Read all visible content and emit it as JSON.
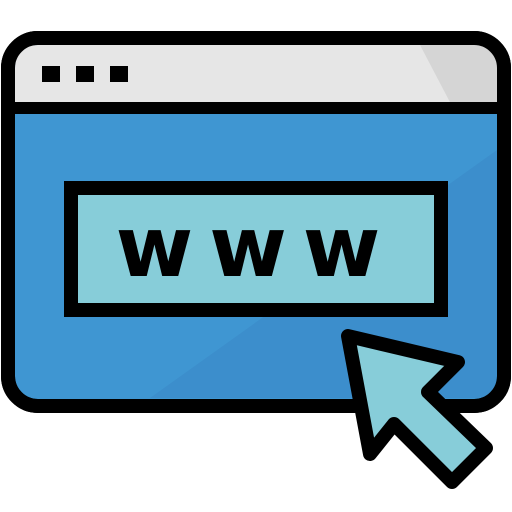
{
  "icon": {
    "name": "web-browser-www-icon",
    "url_label": "www"
  },
  "window": {
    "icons": [
      "titlebar-dot-icon",
      "titlebar-dot-icon",
      "titlebar-dot-icon"
    ]
  },
  "colors": {
    "outline": "#000000",
    "titlebar": "#e6e6e6",
    "titlebar_shade": "#d5d5d5",
    "body": "#3f96d2",
    "body_shade": "#3a89c6",
    "address_bar": "#87cdd9",
    "cursor": "#87cdd9",
    "background": "#ffffff"
  }
}
